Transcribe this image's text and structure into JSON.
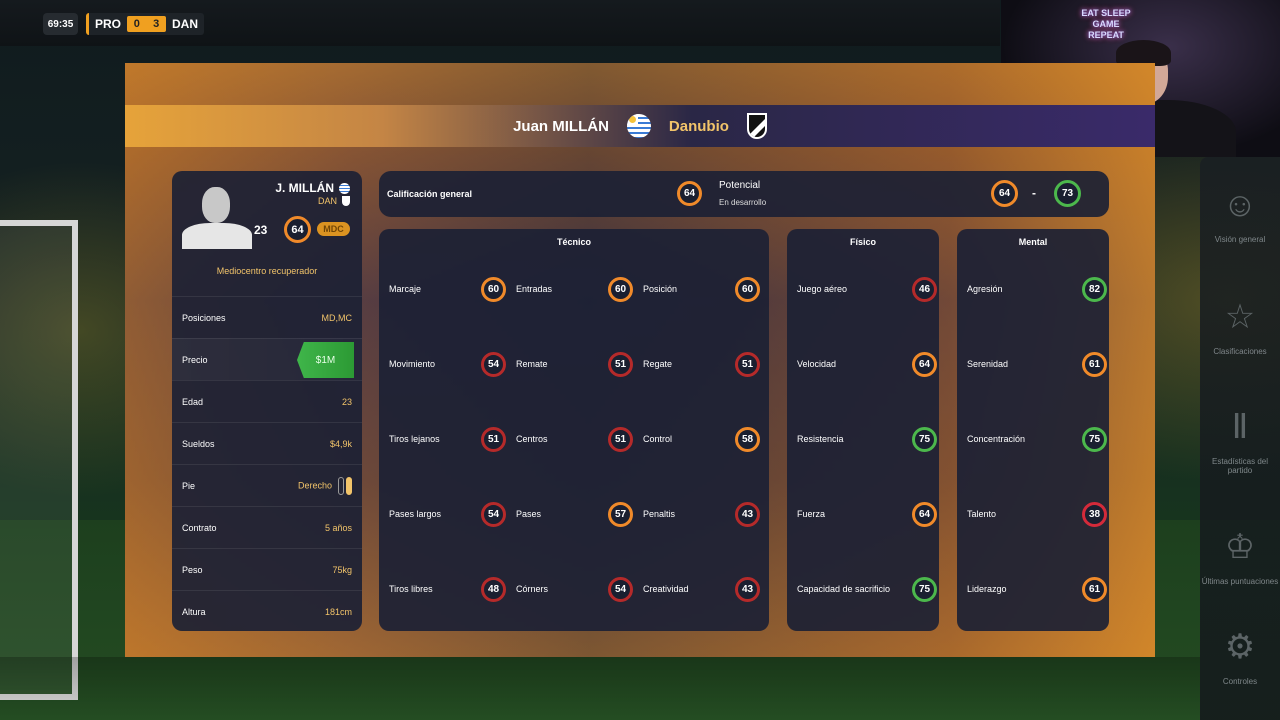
{
  "hud": {
    "time": "69:35",
    "home": "PRO",
    "home_score": "0",
    "away_score": "3",
    "away": "DAN"
  },
  "webcam": {
    "sign": "EAT SLEEP GAME REPEAT"
  },
  "right_menu": [
    {
      "icon": "person-icon",
      "label": "Visión general"
    },
    {
      "icon": "star-icon",
      "label": "Clasificaciones"
    },
    {
      "icon": "bar-chart-icon",
      "label": "Estadísticas del partido"
    },
    {
      "icon": "trophy-icon",
      "label": "Últimas puntuaciones"
    },
    {
      "icon": "gear-icon",
      "label": "Controles"
    }
  ],
  "header": {
    "player_name": "Juan MILLÁN",
    "club": "Danubio"
  },
  "player": {
    "short_name": "J. MILLÁN",
    "team": "DAN",
    "age": "23",
    "overall": "64",
    "position": "MDC",
    "role": "Mediocentro recuperador"
  },
  "info": [
    {
      "label": "Posiciones",
      "value": "MD,MC"
    },
    {
      "label": "Precio",
      "value": "$1M"
    },
    {
      "label": "Edad",
      "value": "23"
    },
    {
      "label": "Sueldos",
      "value": "$4,9k"
    },
    {
      "label": "Pie",
      "value": "Derecho"
    },
    {
      "label": "Contrato",
      "value": "5 años"
    },
    {
      "label": "Peso",
      "value": "75kg"
    },
    {
      "label": "Altura",
      "value": "181cm"
    }
  ],
  "overall": {
    "label": "Calificación general",
    "value": "64",
    "potential_label": "Potencial",
    "potential_status": "En desarrollo",
    "pot_min": "64",
    "separator": "-",
    "pot_max": "73"
  },
  "tecnico": {
    "title": "Técnico",
    "stats": [
      {
        "label": "Marcaje",
        "value": "60"
      },
      {
        "label": "Entradas",
        "value": "60"
      },
      {
        "label": "Posición",
        "value": "60"
      },
      {
        "label": "Movimiento",
        "value": "54"
      },
      {
        "label": "Remate",
        "value": "51"
      },
      {
        "label": "Regate",
        "value": "51"
      },
      {
        "label": "Tiros lejanos",
        "value": "51"
      },
      {
        "label": "Centros",
        "value": "51"
      },
      {
        "label": "Control",
        "value": "58"
      },
      {
        "label": "Pases largos",
        "value": "54"
      },
      {
        "label": "Pases",
        "value": "57"
      },
      {
        "label": "Penaltis",
        "value": "43"
      },
      {
        "label": "Tiros libres",
        "value": "48"
      },
      {
        "label": "Córners",
        "value": "54"
      },
      {
        "label": "Creatividad",
        "value": "43"
      }
    ]
  },
  "fisico": {
    "title": "Físico",
    "stats": [
      {
        "label": "Juego aéreo",
        "value": "46"
      },
      {
        "label": "Velocidad",
        "value": "64"
      },
      {
        "label": "Resistencia",
        "value": "75"
      },
      {
        "label": "Fuerza",
        "value": "64"
      },
      {
        "label": "Capacidad de sacrificio",
        "value": "75"
      }
    ]
  },
  "mental": {
    "title": "Mental",
    "stats": [
      {
        "label": "Agresión",
        "value": "82"
      },
      {
        "label": "Serenidad",
        "value": "61"
      },
      {
        "label": "Concentración",
        "value": "75"
      },
      {
        "label": "Talento",
        "value": "38"
      },
      {
        "label": "Liderazgo",
        "value": "61"
      }
    ]
  },
  "colors": {
    "accent": "#f0a020",
    "gold": "#f2c46a",
    "price_green": "#3fb54a",
    "ring_orange": "#f08a2a",
    "ring_red": "#b52a2a",
    "ring_green": "#4cb84c"
  }
}
